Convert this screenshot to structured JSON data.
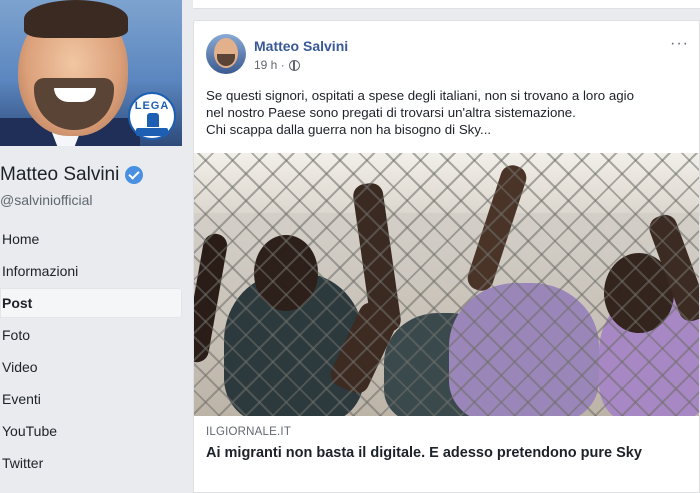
{
  "page": {
    "name": "Matteo Salvini",
    "handle": "@salviniofficial",
    "badge_text": "LEGA"
  },
  "nav": {
    "items": [
      {
        "label": "Home",
        "active": false
      },
      {
        "label": "Informazioni",
        "active": false
      },
      {
        "label": "Post",
        "active": true
      },
      {
        "label": "Foto",
        "active": false
      },
      {
        "label": "Video",
        "active": false
      },
      {
        "label": "Eventi",
        "active": false
      },
      {
        "label": "YouTube",
        "active": false
      },
      {
        "label": "Twitter",
        "active": false
      }
    ]
  },
  "post": {
    "author": "Matteo Salvini",
    "time": "19 h ·",
    "more": "···",
    "text_lines": [
      "Se questi signori, ospitati a spese degli italiani, non si trovano a loro agio",
      "nel nostro Paese sono pregati di trovarsi un'altra sistemazione.",
      "Chi scappa dalla guerra non ha bisogno di Sky..."
    ],
    "link": {
      "source": "ILGIORNALE.IT",
      "title": "Ai migranti non basta il digitale. E adesso pretendono pure Sky"
    }
  },
  "colors": {
    "background": "#e9ebee",
    "author_link": "#385898",
    "verified": "#4a90e2",
    "secondary_text": "#606770"
  },
  "icons": [
    "verified-badge-icon",
    "globe-icon",
    "more-options-icon"
  ]
}
